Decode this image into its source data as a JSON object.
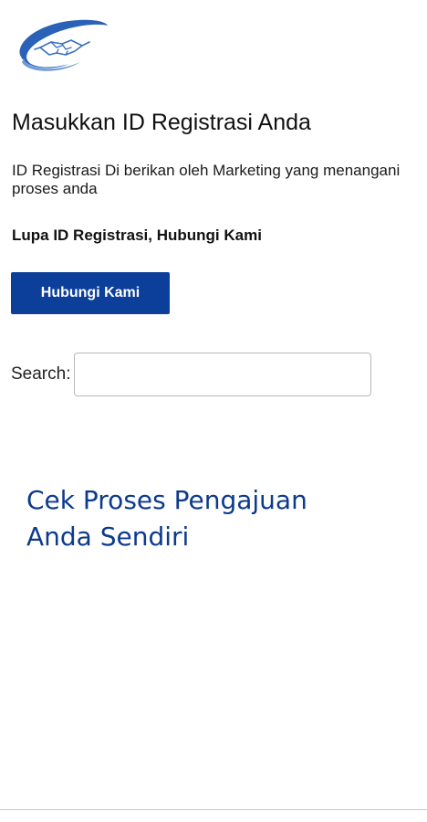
{
  "header": {
    "logo_icon": "handshake-swoosh-logo-icon"
  },
  "main": {
    "title": "Masukkan ID Registrasi Anda",
    "instruction": "ID Registrasi Di berikan oleh Marketing yang menangani proses anda",
    "forgot_text": "Lupa ID Registrasi, Hubungi Kami",
    "contact_button_label": "Hubungi Kami",
    "search": {
      "label": "Search:",
      "value": "",
      "placeholder": ""
    },
    "cta_link": "Cek Proses Pengajuan Anda Sendiri"
  },
  "colors": {
    "primary_button": "#0b3f9a",
    "link": "#0c3a8c",
    "logo_blue": "#2a62b8"
  }
}
